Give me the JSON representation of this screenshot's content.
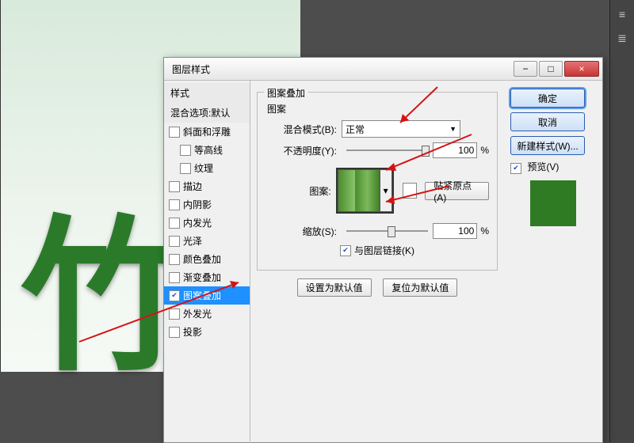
{
  "canvas": {
    "char": "竹"
  },
  "dialog_title": "图层样式",
  "win": {
    "min": "−",
    "max": "□",
    "close": "×"
  },
  "left": {
    "styles": "样式",
    "blend": "混合选项:默认",
    "bevel": "斜面和浮雕",
    "contour": "等高线",
    "texture": "纹理",
    "stroke": "描边",
    "innerShadow": "内阴影",
    "innerGlow": "内发光",
    "satin": "光泽",
    "colorOverlay": "颜色叠加",
    "gradOverlay": "渐变叠加",
    "patternOverlay": "图案叠加",
    "outerGlow": "外发光",
    "dropShadow": "投影"
  },
  "panel": {
    "section": "图案叠加",
    "group": "图案",
    "blendMode": "混合模式(B):",
    "blendVal": "正常",
    "opacity": "不透明度(Y):",
    "opacityVal": "100",
    "pct": "%",
    "patternLabel": "图案:",
    "snap": "贴紧原点(A)",
    "scale": "缩放(S):",
    "scaleVal": "100",
    "link": "与图层链接(K)",
    "check": "✔",
    "setDefault": "设置为默认值",
    "resetDefault": "复位为默认值",
    "dd": "▾"
  },
  "right": {
    "ok": "确定",
    "cancel": "取消",
    "newStyle": "新建样式(W)...",
    "preview": "预览(V)",
    "check": "✔"
  }
}
